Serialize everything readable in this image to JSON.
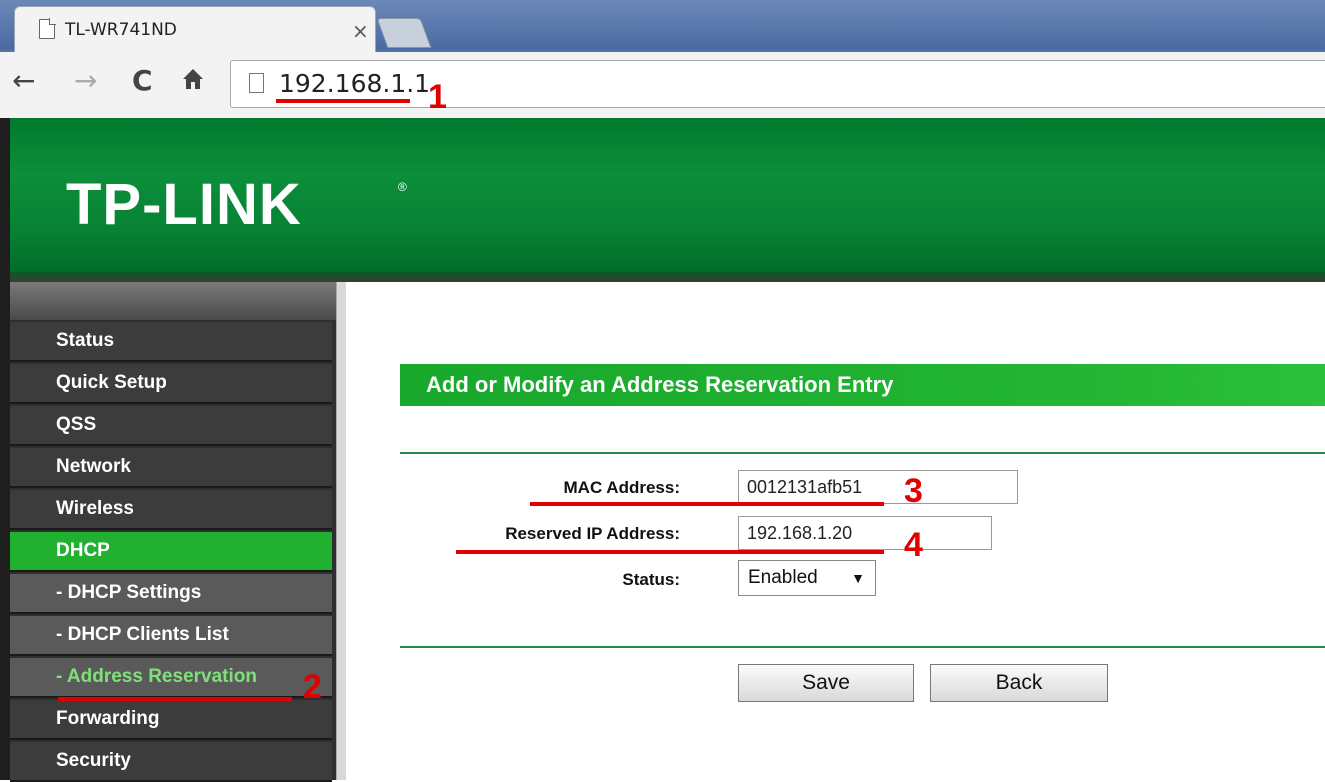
{
  "browser": {
    "tab_title": "TL-WR741ND",
    "tab_close": "×",
    "url": "192.168.1.1",
    "icons": [
      "back-icon",
      "forward-icon",
      "reload-icon",
      "home-icon",
      "page-icon"
    ]
  },
  "annotations": {
    "n1": "1",
    "n2": "2",
    "n3": "3",
    "n4": "4",
    "color": "#e00000"
  },
  "header": {
    "logo": "TP-LINK",
    "logo_reg": "®",
    "color": "#0c8e3a"
  },
  "sidebar": {
    "items": [
      {
        "label": "Status",
        "kind": "menu"
      },
      {
        "label": "Quick Setup",
        "kind": "menu"
      },
      {
        "label": "QSS",
        "kind": "menu"
      },
      {
        "label": "Network",
        "kind": "menu"
      },
      {
        "label": "Wireless",
        "kind": "menu"
      },
      {
        "label": "DHCP",
        "kind": "active"
      },
      {
        "label": "- DHCP Settings",
        "kind": "sub"
      },
      {
        "label": "- DHCP Clients List",
        "kind": "sub"
      },
      {
        "label": "- Address Reservation",
        "kind": "current"
      },
      {
        "label": "Forwarding",
        "kind": "menu"
      },
      {
        "label": "Security",
        "kind": "menu"
      }
    ]
  },
  "form": {
    "title": "Add or Modify an Address Reservation Entry",
    "mac_label": "MAC Address:",
    "mac_value": "0012131afb51",
    "ip_label": "Reserved IP Address:",
    "ip_value": "192.168.1.20",
    "status_label": "Status:",
    "status_value": "Enabled",
    "save_label": "Save",
    "back_label": "Back"
  }
}
